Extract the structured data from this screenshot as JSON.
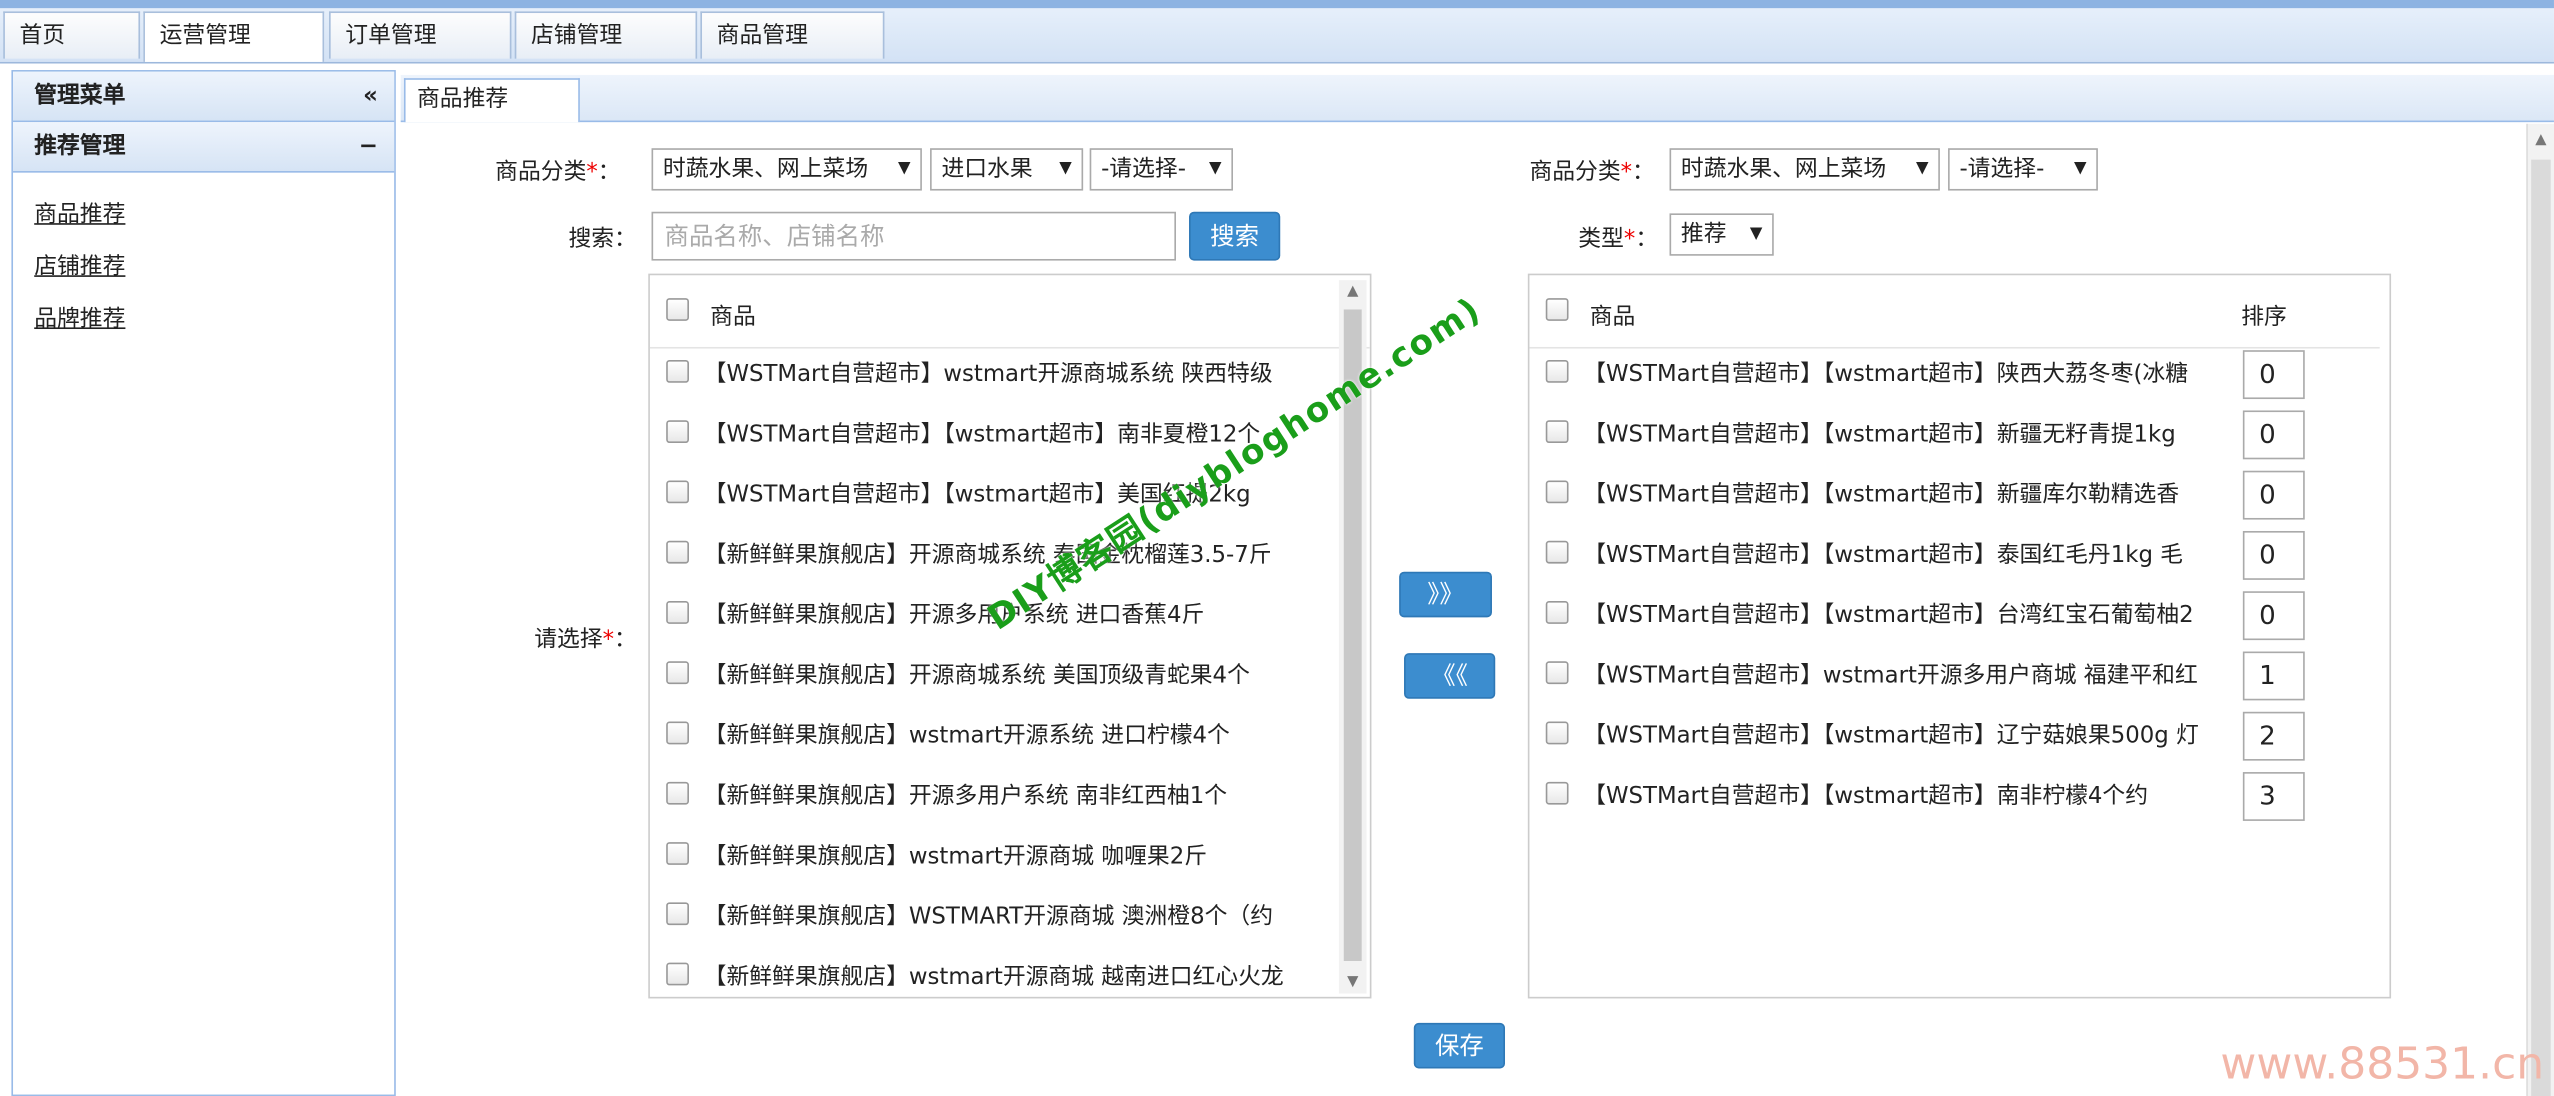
{
  "top_tabs": [
    "首页",
    "运营管理",
    "订单管理",
    "店铺管理",
    "商品管理"
  ],
  "sidebar": {
    "menu_title": "管理菜单",
    "collapse_icon": "«",
    "section_title": "推荐管理",
    "section_toggle": "−",
    "links": [
      "商品推荐",
      "店铺推荐",
      "品牌推荐"
    ]
  },
  "main_tab": "商品推荐",
  "left_form": {
    "category_label": "商品分类",
    "category_selects": [
      "时蔬水果、网上菜场",
      "进口水果",
      "-请选择-"
    ],
    "search_label": "搜索：",
    "search_placeholder": "商品名称、店铺名称",
    "search_button": "搜索",
    "select_label": "请选择",
    "list_header": "商品",
    "items": [
      "【WSTMart自营超市】wstmart开源商城系统 陕西特级",
      "【WSTMart自营超市】【wstmart超市】南非夏橙12个",
      "【WSTMart自营超市】【wstmart超市】美国红提2kg",
      "【新鲜鲜果旗舰店】开源商城系统 泰国金枕榴莲3.5-7斤",
      "【新鲜鲜果旗舰店】开源多用户系统 进口香蕉4斤",
      "【新鲜鲜果旗舰店】开源商城系统 美国顶级青蛇果4个",
      "【新鲜鲜果旗舰店】wstmart开源系统 进口柠檬4个",
      "【新鲜鲜果旗舰店】开源多用户系统 南非红西柚1个",
      "【新鲜鲜果旗舰店】wstmart开源商城 咖喱果2斤",
      "【新鲜鲜果旗舰店】WSTMART开源商城 澳洲橙8个（约",
      "【新鲜鲜果旗舰店】wstmart开源商城 越南进口红心火龙"
    ]
  },
  "move_right": "》》",
  "move_left": "《《",
  "right_form": {
    "category_label": "商品分类",
    "category_selects": [
      "时蔬水果、网上菜场",
      "-请选择-"
    ],
    "type_label": "类型",
    "type_select": "推荐",
    "list_header": "商品",
    "sort_header": "排序",
    "items": [
      {
        "name": "【WSTMart自营超市】【wstmart超市】陕西大荔冬枣(冰糖",
        "sort": "0"
      },
      {
        "name": "【WSTMart自营超市】【wstmart超市】新疆无籽青提1kg",
        "sort": "0"
      },
      {
        "name": "【WSTMart自营超市】【wstmart超市】新疆库尔勒精选香",
        "sort": "0"
      },
      {
        "name": "【WSTMart自营超市】【wstmart超市】泰国红毛丹1kg 毛",
        "sort": "0"
      },
      {
        "name": "【WSTMart自营超市】【wstmart超市】台湾红宝石葡萄柚2",
        "sort": "0"
      },
      {
        "name": "【WSTMart自营超市】wstmart开源多用户商城 福建平和红",
        "sort": "1"
      },
      {
        "name": "【WSTMart自营超市】【wstmart超市】辽宁菇娘果500g 灯",
        "sort": "2"
      },
      {
        "name": "【WSTMart自营超市】【wstmart超市】南非柠檬4个约",
        "sort": "3"
      }
    ]
  },
  "save_button": "保存",
  "watermark": "DIY博客园(diybloghome.com)",
  "site_watermark": "www.88531.cn"
}
